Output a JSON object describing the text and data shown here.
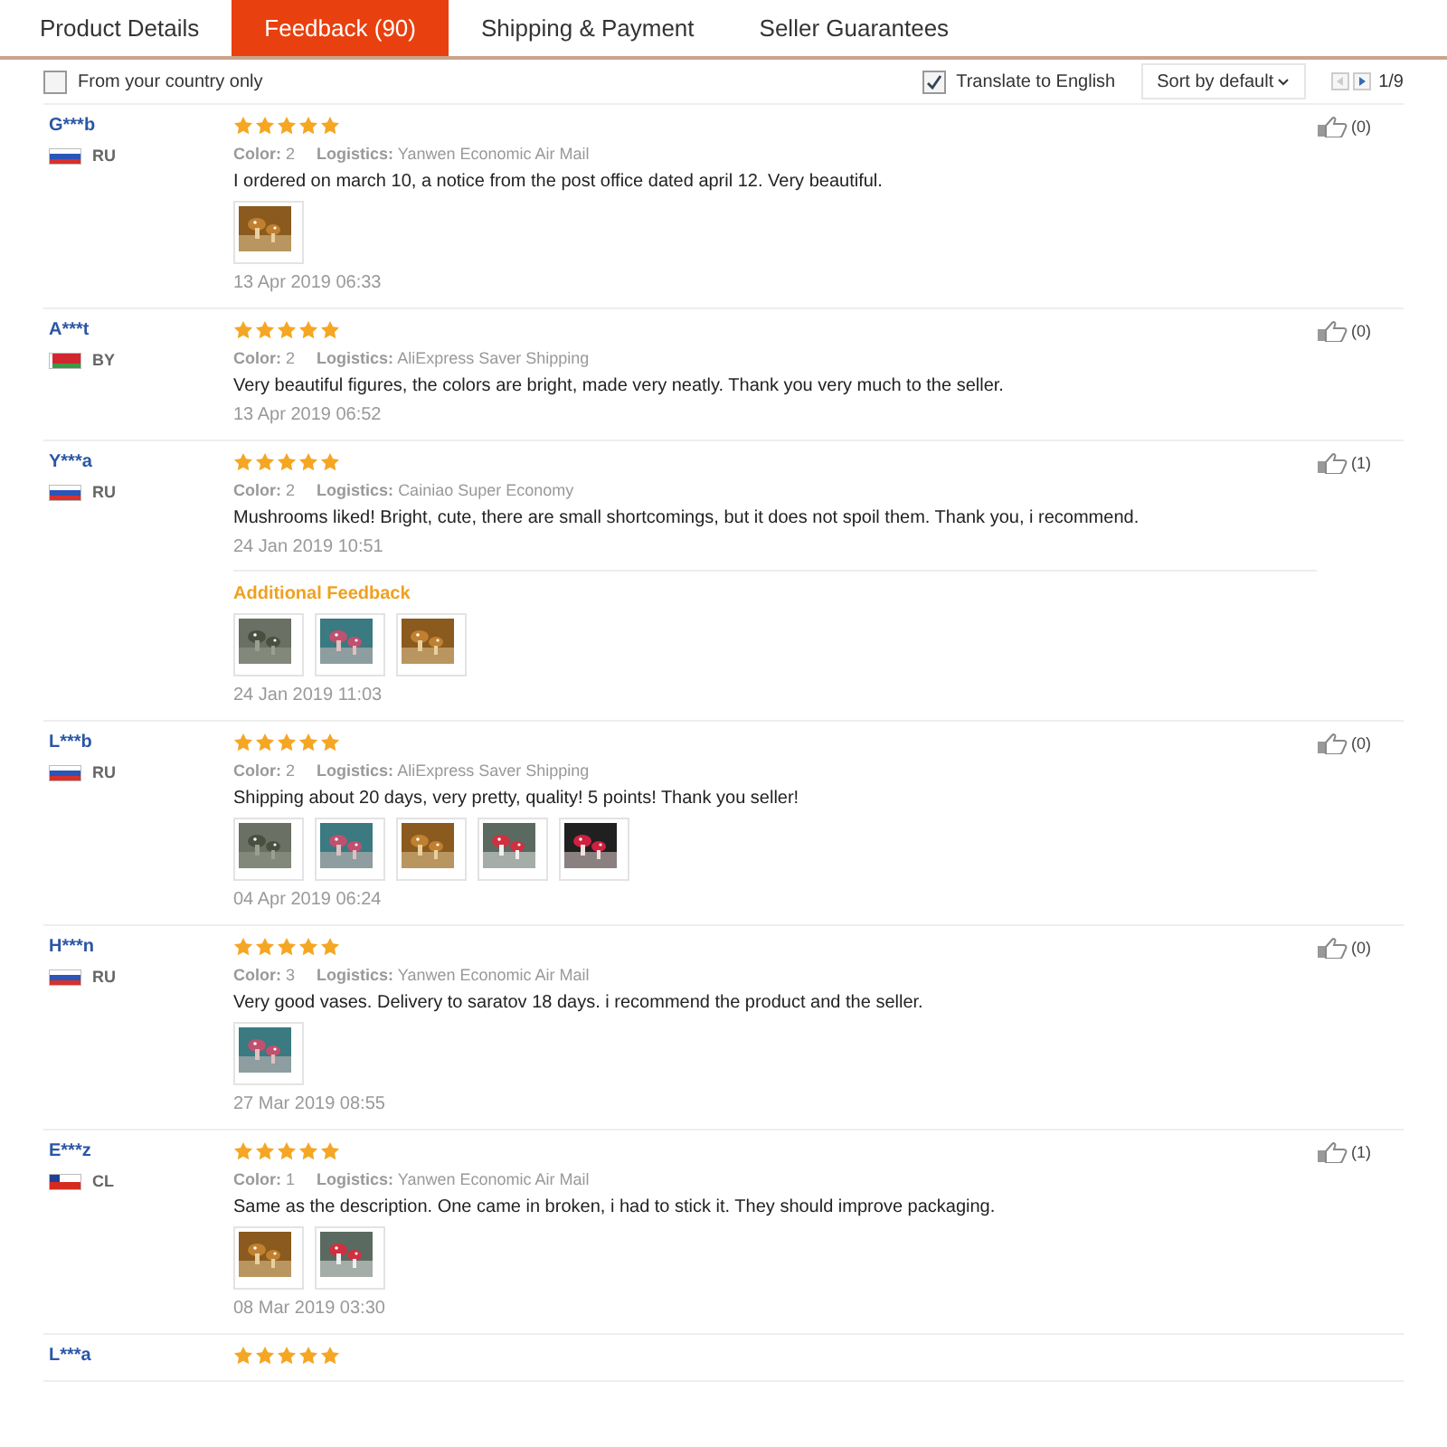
{
  "tabs": [
    {
      "label": "Product Details",
      "selected": false
    },
    {
      "label": "Feedback (90)",
      "selected": true
    },
    {
      "label": "Shipping & Payment",
      "selected": false
    },
    {
      "label": "Seller Guarantees",
      "selected": false
    }
  ],
  "filters": {
    "country_only": {
      "label": "From your country only",
      "checked": false
    },
    "translate": {
      "label": "Translate to English",
      "checked": true
    },
    "sort": "Sort by default",
    "pager": {
      "prev_disabled": true,
      "next_disabled": false,
      "page": "1/9"
    }
  },
  "reviews": [
    {
      "name": "G***b",
      "country": "RU",
      "flag": {
        "kind": "triband"
      },
      "stars": 5,
      "color_label": "Color:",
      "color_value": "2",
      "logistics_label": "Logistics:",
      "logistics_value": "Yanwen Economic Air Mail",
      "text": "I ordered on march 10, a notice from the post office dated april 12. Very beautiful.",
      "photos": [
        {
          "kind": "picture"
        }
      ],
      "date": "13 Apr 2019 06:33",
      "likes": "(0)"
    },
    {
      "name": "A***t",
      "country": "BY",
      "flag": {
        "kind": "biband"
      },
      "stars": 5,
      "color_label": "Color:",
      "color_value": "2",
      "logistics_label": "Logistics:",
      "logistics_value": "AliExpress Saver Shipping",
      "text": "Very beautiful figures, the colors are bright, made very neatly. Thank you very much to the seller.",
      "date": "13 Apr 2019 06:52",
      "likes": "(0)"
    },
    {
      "name": "Y***a",
      "country": "RU",
      "flag": {
        "kind": "triband"
      },
      "stars": 5,
      "color_label": "Color:",
      "color_value": "2",
      "logistics_label": "Logistics:",
      "logistics_value": "Cainiao Super Economy",
      "text": "Mushrooms liked! Bright, cute, there are small shortcomings, but it does not spoil them. Thank you, i recommend.",
      "date": "24 Jan 2019 10:51",
      "likes": "(1)",
      "additional": {
        "title": "Additional Feedback",
        "photos": [
          {
            "kind": "picture"
          },
          {
            "kind": "picture"
          },
          {
            "kind": "picture"
          }
        ],
        "date": "24 Jan 2019 11:03"
      }
    },
    {
      "name": "L***b",
      "country": "RU",
      "flag": {
        "kind": "triband"
      },
      "stars": 5,
      "color_label": "Color:",
      "color_value": "2",
      "logistics_label": "Logistics:",
      "logistics_value": "AliExpress Saver Shipping",
      "text": "Shipping about 20 days, very pretty, quality! 5 points! Thank you seller!",
      "photos": [
        {
          "kind": "picture"
        },
        {
          "kind": "picture"
        },
        {
          "kind": "picture"
        },
        {
          "kind": "picture"
        },
        {
          "kind": "picture"
        }
      ],
      "date": "04 Apr 2019 06:24",
      "likes": "(0)"
    },
    {
      "name": "H***n",
      "country": "RU",
      "flag": {
        "kind": "triband"
      },
      "stars": 5,
      "color_label": "Color:",
      "color_value": "3",
      "logistics_label": "Logistics:",
      "logistics_value": "Yanwen Economic Air Mail",
      "text": "Very good vases. Delivery to saratov 18 days. i recommend the product and the seller.",
      "photos": [
        {
          "kind": "picture"
        }
      ],
      "date": "27 Mar 2019 08:55",
      "likes": "(0)"
    },
    {
      "name": "E***z",
      "country": "CL",
      "flag": {
        "kind": "canton"
      },
      "stars": 5,
      "color_label": "Color:",
      "color_value": "1",
      "logistics_label": "Logistics:",
      "logistics_value": "Yanwen Economic Air Mail",
      "text": "Same as the description. One came in broken, i had to stick it. They should improve packaging.",
      "photos": [
        {
          "kind": "picture"
        },
        {
          "kind": "picture"
        }
      ],
      "date": "08 Mar 2019 03:30",
      "likes": "(1)"
    },
    {
      "name": "L***a",
      "stars": 5
    }
  ]
}
